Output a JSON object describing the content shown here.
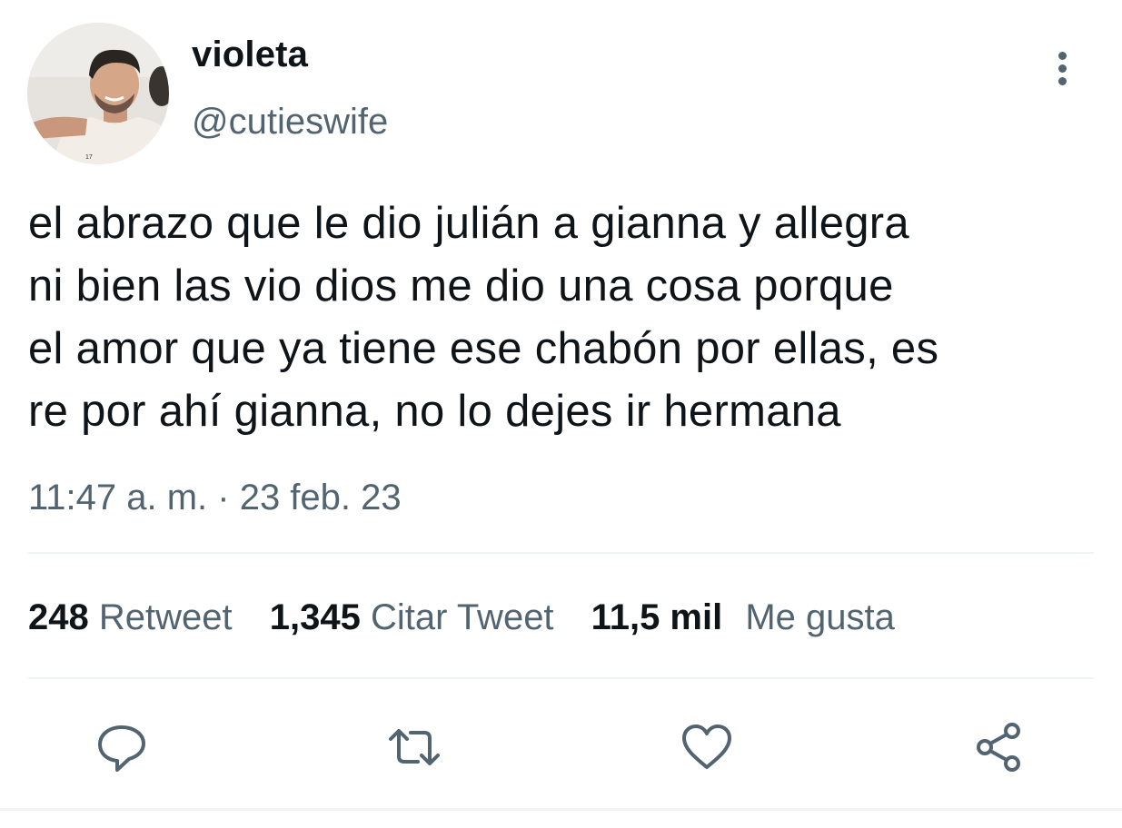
{
  "author": {
    "display_name": "violeta",
    "handle": "@cutieswife",
    "avatar": "profile-photo"
  },
  "tweet": {
    "lines": [
      "el abrazo que le dio julián a gianna y allegra",
      "ni bien las vio dios me dio una cosa porque",
      "el amor que ya tiene ese chabón por ellas, es",
      "re por ahí gianna, no lo dejes ir hermana"
    ],
    "timestamp": "11:47 a. m. · 23 feb. 23"
  },
  "stats": {
    "retweets_count": "248",
    "retweets_label": "Retweet",
    "quotes_count": "1,345",
    "quotes_label": "Citar Tweet",
    "likes_count": "11,5 mil",
    "likes_label": "Me gusta"
  },
  "actions": [
    "reply-icon",
    "retweet-icon",
    "like-icon",
    "share-icon"
  ],
  "colors": {
    "text_primary": "#0f1419",
    "text_secondary": "#536471",
    "divider": "#eff3f4"
  }
}
